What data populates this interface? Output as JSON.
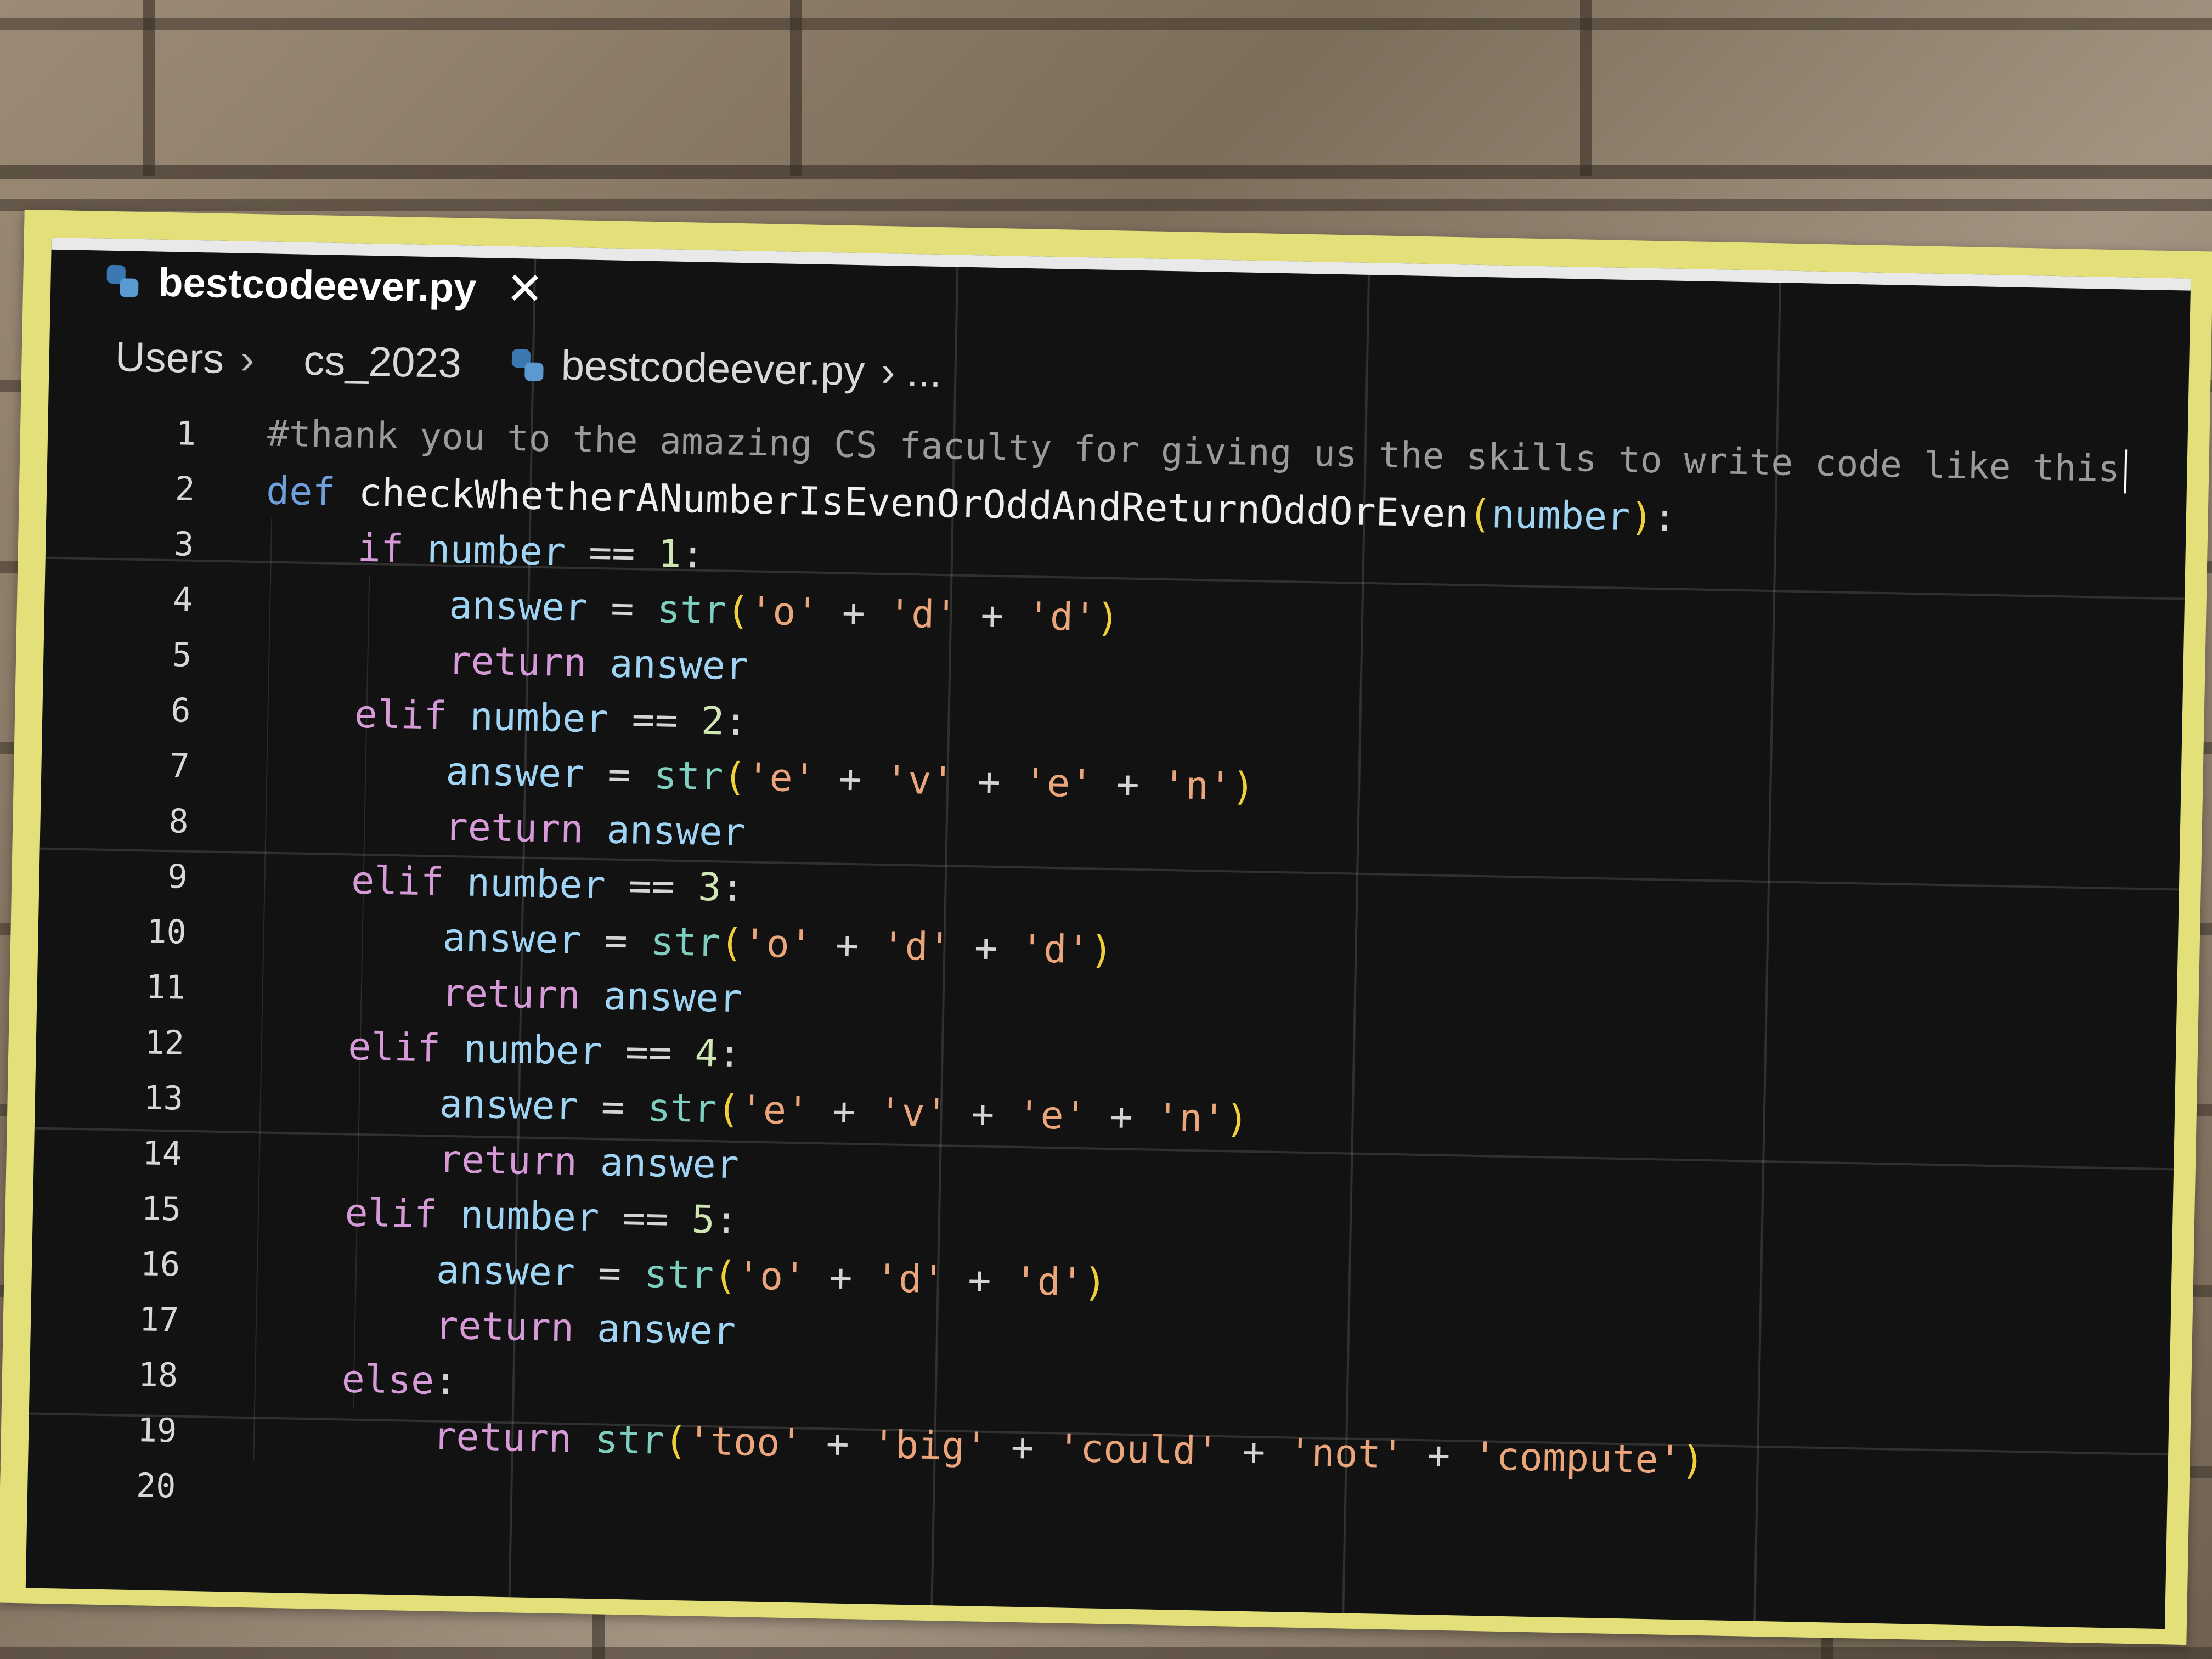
{
  "tab": {
    "filename": "bestcodeever.py",
    "close_glyph": "✕"
  },
  "breadcrumb": {
    "items": [
      "Users",
      "cs_2023"
    ],
    "separator": "›",
    "file": "bestcodeever.py",
    "trailing": "› ..."
  },
  "lines": [
    {
      "n": "1"
    },
    {
      "n": "2"
    },
    {
      "n": "3"
    },
    {
      "n": "4"
    },
    {
      "n": "5"
    },
    {
      "n": "6"
    },
    {
      "n": "7"
    },
    {
      "n": "8"
    },
    {
      "n": "9"
    },
    {
      "n": "10"
    },
    {
      "n": "11"
    },
    {
      "n": "12"
    },
    {
      "n": "13"
    },
    {
      "n": "14"
    },
    {
      "n": "15"
    },
    {
      "n": "16"
    },
    {
      "n": "17"
    },
    {
      "n": "18"
    },
    {
      "n": "19"
    },
    {
      "n": "20"
    }
  ],
  "code": {
    "comment": "#thank you to the amazing CS faculty for giving us the skills to write code like this",
    "def_kw": "def",
    "func_name": "checkWhetherANumberIsEvenOrOddAndReturnOddOrEven",
    "param": "number",
    "if_kw": "if",
    "elif_kw": "elif",
    "else_kw": "else",
    "return_kw": "return",
    "var_answer": "answer",
    "var_number": "number",
    "builtin_str": "str",
    "n1": "1",
    "n2": "2",
    "n3": "3",
    "n4": "4",
    "n5": "5",
    "s_o": "'o'",
    "s_d": "'d'",
    "s_e": "'e'",
    "s_v": "'v'",
    "s_n": "'n'",
    "s_too": "'too'",
    "s_big": "'big'",
    "s_could": "'could'",
    "s_not": "'not'",
    "s_compute": "'compute'"
  },
  "icons": {
    "python_file": "python-file-icon",
    "close": "close-icon"
  },
  "colors": {
    "background": "#121212",
    "keyword": "#6fa0dd",
    "control_keyword": "#d79ad8",
    "variable": "#9fd4f4",
    "string": "#eba57a",
    "builtin": "#7fcfc0",
    "parenthesis": "#f0d038",
    "comment": "#9a9a9a",
    "tape": "#e3e07a"
  }
}
